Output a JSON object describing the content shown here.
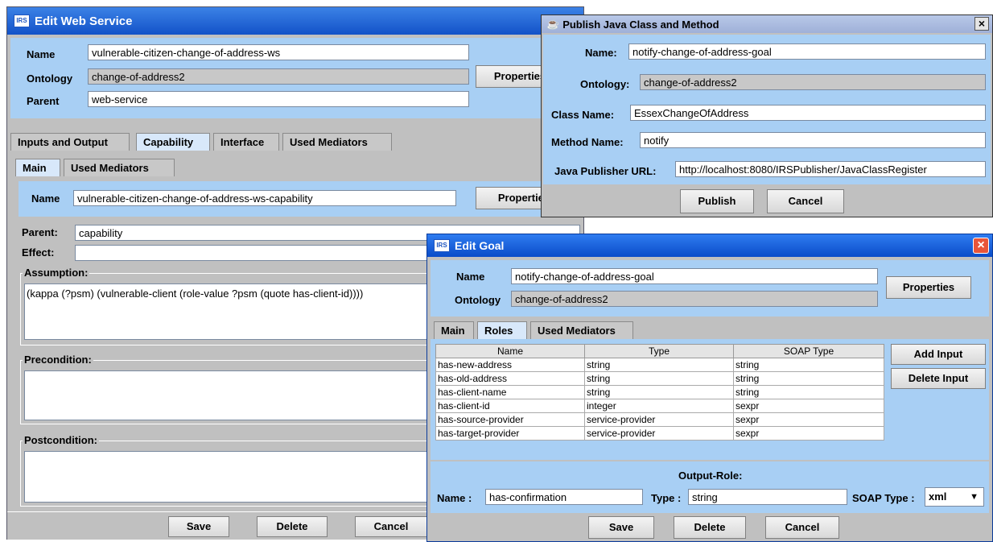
{
  "edit_ws": {
    "title": "Edit Web Service",
    "name_label": "Name",
    "name_value": "vulnerable-citizen-change-of-address-ws",
    "ontology_label": "Ontology",
    "ontology_value": "change-of-address2",
    "parent_label": "Parent",
    "parent_value": "web-service",
    "properties_label": "Properties",
    "tabs": [
      "Inputs and Output",
      "Capability",
      "Interface",
      "Used Mediators"
    ],
    "subtabs": [
      "Main",
      "Used Mediators"
    ],
    "cap_name_label": "Name",
    "cap_name_value": "vulnerable-citizen-change-of-address-ws-capability",
    "cap_properties_label": "Properties",
    "cap_parent_label": "Parent:",
    "cap_parent_value": "capability",
    "effect_label": "Effect:",
    "effect_value": "",
    "assumption_label": "Assumption:",
    "assumption_value": "(kappa (?psm) (vulnerable-client (role-value ?psm (quote has-client-id))))",
    "precondition_label": "Precondition:",
    "postcondition_label": "Postcondition:",
    "save_label": "Save",
    "delete_label": "Delete",
    "cancel_label": "Cancel"
  },
  "publish": {
    "title": "Publish Java Class and Method",
    "close_glyph": "×",
    "name_label": "Name:",
    "name_value": "notify-change-of-address-goal",
    "ontology_label": "Ontology:",
    "ontology_value": "change-of-address2",
    "class_label": "Class Name:",
    "class_value": "EssexChangeOfAddress",
    "method_label": "Method Name:",
    "method_value": "notify",
    "url_label": "Java Publisher URL:",
    "url_value": "http://localhost:8080/IRSPublisher/JavaClassRegister",
    "publish_label": "Publish",
    "cancel_label": "Cancel"
  },
  "edit_goal": {
    "title": "Edit Goal",
    "close_glyph": "×",
    "name_label": "Name",
    "name_value": "notify-change-of-address-goal",
    "ontology_label": "Ontology",
    "ontology_value": "change-of-address2",
    "properties_label": "Properties",
    "tabs": [
      "Main",
      "Roles",
      "Used Mediators"
    ],
    "columns": [
      "Name",
      "Type",
      "SOAP Type"
    ],
    "rows": [
      [
        "has-new-address",
        "string",
        "string"
      ],
      [
        "has-old-address",
        "string",
        "string"
      ],
      [
        "has-client-name",
        "string",
        "string"
      ],
      [
        "has-client-id",
        "integer",
        "sexpr"
      ],
      [
        "has-source-provider",
        "service-provider",
        "sexpr"
      ],
      [
        "has-target-provider",
        "service-provider",
        "sexpr"
      ]
    ],
    "add_input_label": "Add  Input",
    "delete_input_label": "Delete Input",
    "output_role_label": "Output-Role:",
    "out_name_label": "Name :",
    "out_name_value": "has-confirmation",
    "out_type_label": "Type :",
    "out_type_value": "string",
    "out_soap_label": "SOAP Type :",
    "out_soap_value": "xml",
    "save_label": "Save",
    "delete_label": "Delete",
    "cancel_label": "Cancel"
  },
  "logo_text": "IRS",
  "colors": {
    "title_blue": "#1a5ed6",
    "panel_blue": "#a8cff4",
    "window_gray": "#c0c0c0"
  }
}
